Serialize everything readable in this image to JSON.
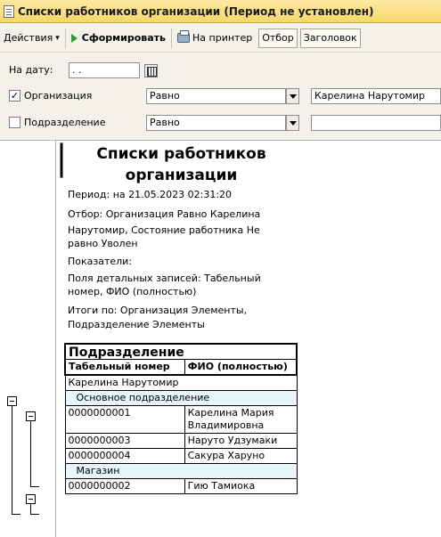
{
  "window": {
    "title": "Списки работников организации (Период не установлен)"
  },
  "toolbar": {
    "actions_label": "Действия",
    "actions_arrow": "▾",
    "generate_label": "Сформировать",
    "print_label": "На принтер",
    "filter_label": "Отбор",
    "header_label": "Заголовок"
  },
  "form": {
    "date_label": "На дату:",
    "date_value": " .  .",
    "org_checkbox_label": "Организация",
    "org_checked": "✓",
    "org_condition": "Равно",
    "org_value": "Карелина Нарутомир",
    "dept_checkbox_label": "Подразделение",
    "dept_condition": "Равно",
    "dept_value": ""
  },
  "report": {
    "title_line1": "Списки работников",
    "title_line2": "организации",
    "period": "Период: на 21.05.2023 02:31:20",
    "filter": [
      "Отбор: Организация Равно Карелина",
      "Нарутомир, Состояние работника Не",
      "равно Уволен"
    ],
    "indicators": "Показатели:",
    "detail_fields": [
      "Поля детальных записей:  Табельный",
      "номер, ФИО (полностью)"
    ],
    "totals": [
      "Итоги по:  Организация Элементы,",
      "Подразделение Элементы"
    ],
    "table": {
      "group_header": "Подразделение",
      "col_tab_number": "Табельный номер",
      "col_fio": "ФИО (полностью)",
      "org_row": "Карелина Нарутомир",
      "dept1": "Основное подразделение",
      "dept1_rows": [
        {
          "num": "0000000001",
          "fio": "Карелина Мария Владимировна"
        },
        {
          "num": "0000000003",
          "fio": "Наруто Удзумаки"
        },
        {
          "num": "0000000004",
          "fio": "Сакура Харуно"
        }
      ],
      "dept2": "Магазин",
      "dept2_rows": [
        {
          "num": "0000000002",
          "fio": "Гию Тамиока"
        }
      ]
    }
  },
  "colors": {
    "title_bar": "#f6d76a",
    "group_row": "#e6f6fa",
    "form_bg": "#f3f1e9"
  }
}
